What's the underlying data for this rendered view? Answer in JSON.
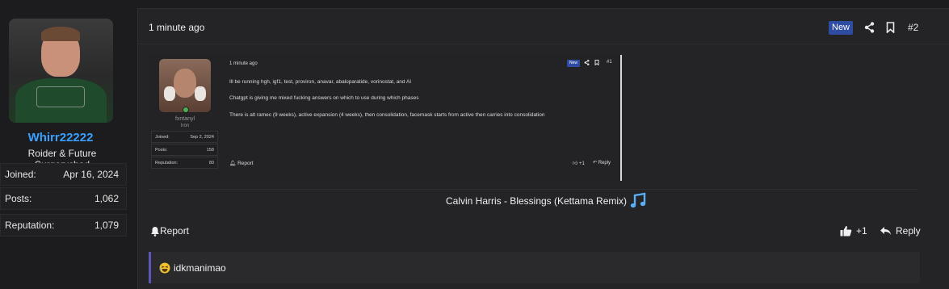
{
  "user": {
    "username": "Whirr22222",
    "title": "Roider & Future Surgerychad",
    "stats": [
      {
        "label": "Joined:",
        "value": "Apr 16, 2024"
      },
      {
        "label": "Posts:",
        "value": "1,062"
      },
      {
        "label": "Reputation:",
        "value": "1,079"
      }
    ]
  },
  "post": {
    "time": "1 minute ago",
    "badge": "New",
    "number": "#2",
    "song": "Calvin Harris - Blessings (Kettama Remix)",
    "report_label": "Report",
    "like_count": "+1",
    "reply_label": "Reply",
    "reaction_text": "idkmanimao"
  },
  "embedded": {
    "username": "fxntanyl",
    "rank": "Iron",
    "stats": [
      {
        "label": "Joined:",
        "value": "Sep 2, 2024"
      },
      {
        "label": "Posts:",
        "value": "158"
      },
      {
        "label": "Reputation:",
        "value": "80"
      }
    ],
    "time": "1 minute ago",
    "badge": "New",
    "number": "#1",
    "lines": [
      "Ill be running hgh, igf1, test, proviron, anavar, abaloparatide, vorinostat, and AI",
      "Chatgpt is giving me mixed fucking answers on which to use during which phases",
      "There is alt ramec (9 weeks), active expansion (4 weeks), then consolidation, facemask starts from active then carries into consolidation"
    ],
    "report_label": "Report",
    "like_count": "+1",
    "reply_label": "Reply"
  },
  "colors": {
    "accent_username": "#3aa0ff",
    "badge_new": "#2f4ca3",
    "reaction_bar": "#5a58b8"
  },
  "icons": [
    "share-icon",
    "bookmark-icon",
    "bell-icon",
    "thumbs-up-icon",
    "reply-icon",
    "music-note-icon",
    "laughing-emoji-icon"
  ]
}
